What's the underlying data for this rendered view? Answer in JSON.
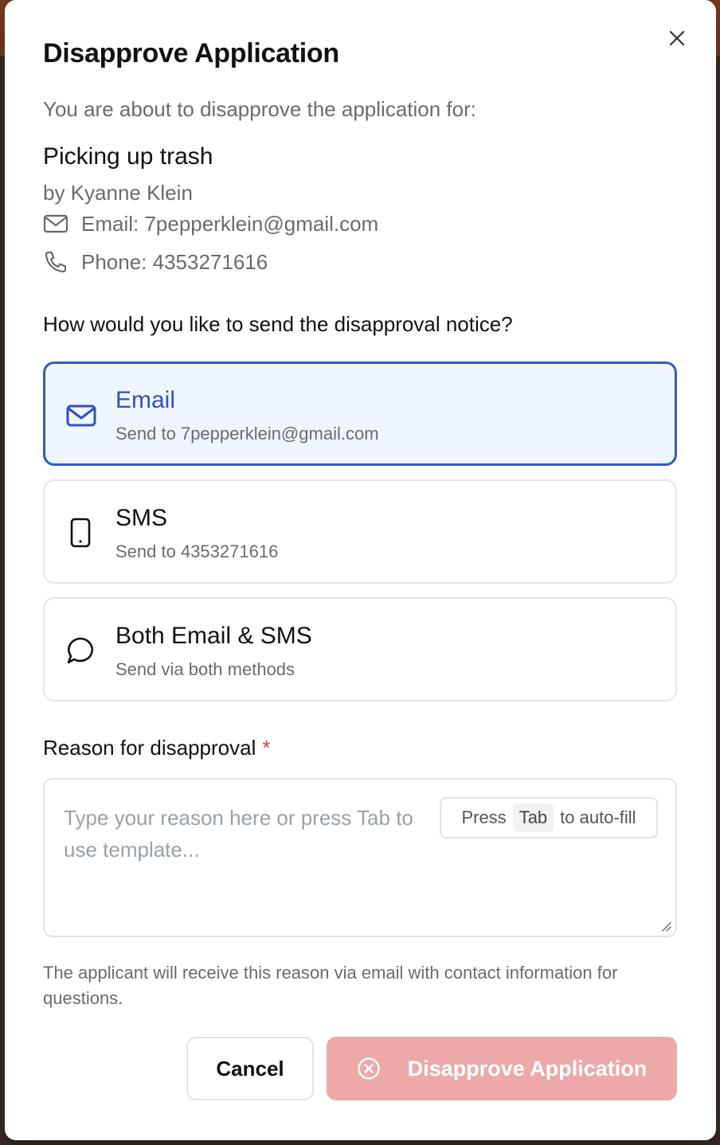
{
  "dialog": {
    "title": "Disapprove Application",
    "subtitle": "You are about to disapprove the application for:",
    "close_icon": "close-icon"
  },
  "application": {
    "name": "Picking up trash",
    "by": "by Kyanne Klein",
    "email_line": "Email: 7pepperklein@gmail.com",
    "phone_line": "Phone: 4353271616"
  },
  "delivery": {
    "question": "How would you like to send the disapproval notice?",
    "selected": "email",
    "options": [
      {
        "id": "email",
        "title": "Email",
        "sub": "Send to 7pepperklein@gmail.com",
        "icon": "mail-icon"
      },
      {
        "id": "sms",
        "title": "SMS",
        "sub": "Send to 4353271616",
        "icon": "phone-device-icon"
      },
      {
        "id": "both",
        "title": "Both Email & SMS",
        "sub": "Send via both methods",
        "icon": "chat-bubble-icon"
      }
    ]
  },
  "reason": {
    "label": "Reason for disapproval",
    "required_mark": "*",
    "placeholder": "Type your reason here or press Tab to use template...",
    "value": "",
    "hint_prefix": "Press",
    "hint_key": "Tab",
    "hint_suffix": "to auto-fill",
    "helper": "The applicant will receive this reason via email with contact information for questions."
  },
  "actions": {
    "cancel_label": "Cancel",
    "disapprove_label": "Disapprove Application",
    "disapprove_enabled": false
  },
  "colors": {
    "accent": "#2f5cc4",
    "selected_bg": "#eef5fd",
    "danger_disabled": "#eda9a8",
    "required": "#d9413b"
  }
}
